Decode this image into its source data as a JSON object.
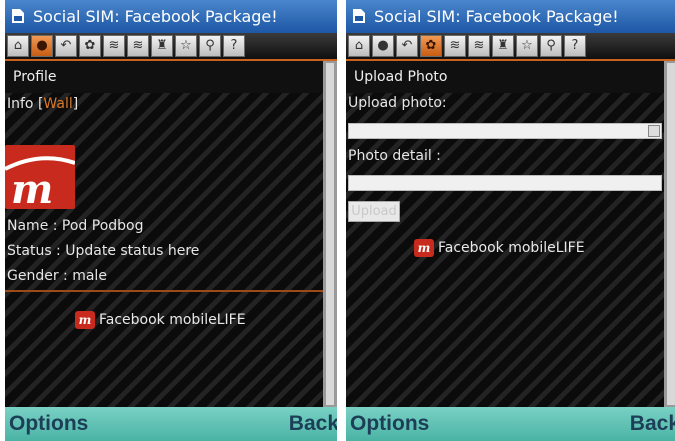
{
  "app": {
    "title": "Social SIM: Facebook Package!",
    "toolbar_icons": [
      "home-icon",
      "profile-icon",
      "back-arrow-icon",
      "photo-icon",
      "feed-icon",
      "feed-alt-icon",
      "friends-icon",
      "star-icon",
      "search-icon",
      "help-icon"
    ]
  },
  "left": {
    "section_title": "Profile",
    "info_label": "Info [",
    "wall_link": "Wall",
    "info_close": "]",
    "name": "Name : Pod Podbog",
    "status": "Status : Update status here",
    "gender": "Gender : male",
    "brand": "Facebook mobileLIFE",
    "active_tool": "profile-icon"
  },
  "right": {
    "section_title": "Upload Photo",
    "upload_photo_label": "Upload photo:",
    "upload_photo_value": "",
    "photo_detail_label": "Photo detail :",
    "photo_detail_value": "",
    "upload_button": "Upload",
    "brand": "Facebook mobileLIFE",
    "active_tool": "photo-icon"
  },
  "softkeys": {
    "left": "Options",
    "right": "Back"
  },
  "colors": {
    "accent": "#c8621c",
    "titlebar": "#1d57a6",
    "softkeys": "#5fc2b4",
    "brand_red": "#c82a1d"
  }
}
